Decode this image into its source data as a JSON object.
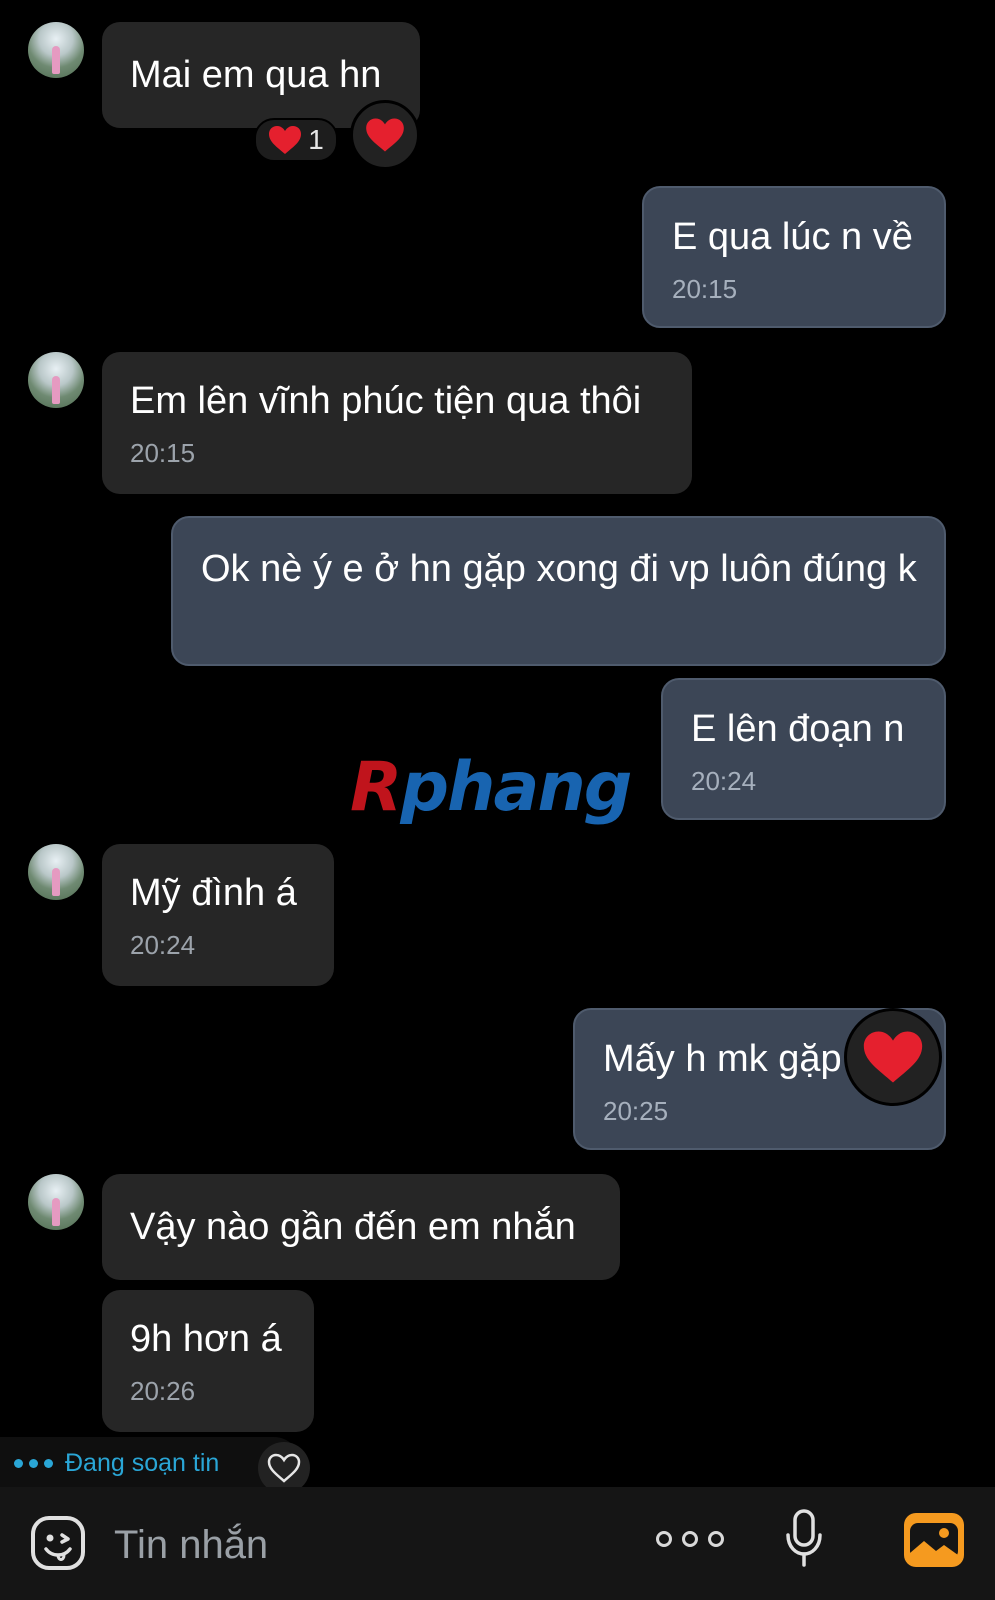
{
  "messages": [
    {
      "side": "received",
      "text": "Mai em qua hn",
      "time": "",
      "reaction_count": "1"
    },
    {
      "side": "sent",
      "text": "E qua lúc n về",
      "time": "20:15"
    },
    {
      "side": "received",
      "text": "Em lên vĩnh phúc tiện qua thôi",
      "time": "20:15"
    },
    {
      "side": "sent",
      "text": "Ok nè ý e ở hn gặp xong đi vp luôn đúng k",
      "time": ""
    },
    {
      "side": "sent",
      "text": "E lên đoạn n",
      "time": "20:24"
    },
    {
      "side": "received",
      "text": "Mỹ đình á",
      "time": "20:24"
    },
    {
      "side": "sent",
      "text": "Mấy h mk gặp",
      "time": "20:25"
    },
    {
      "side": "received",
      "text": "Vậy nào gần đến em nhắn",
      "time": ""
    },
    {
      "side": "received",
      "text": "9h hơn á",
      "time": "20:26"
    }
  ],
  "watermark": {
    "first": "R",
    "rest": "phang"
  },
  "typing_indicator": "Đang soạn tin",
  "composer": {
    "placeholder": "Tin nhắn"
  },
  "icons": {
    "heart": "heart-icon",
    "emoji": "emoji-icon",
    "more": "more-icon",
    "mic": "microphone-icon",
    "photo": "photo-icon"
  },
  "colors": {
    "background": "#000000",
    "received_bubble": "#262626",
    "sent_bubble": "#3c4656",
    "accent_typing": "#2aa6d6",
    "photo_icon": "#f59a1f",
    "heart": "#e5202e"
  }
}
